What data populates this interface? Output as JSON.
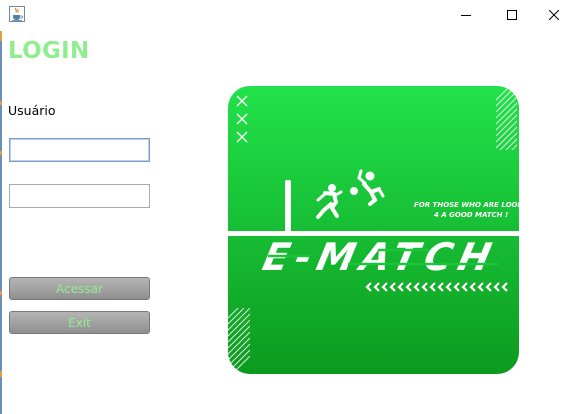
{
  "window": {
    "icon": "java-cup-icon",
    "controls": [
      "minimize-icon",
      "maximize-icon",
      "close-icon"
    ]
  },
  "form": {
    "title": "LOGIN",
    "user_label": "Usuário",
    "user_value": "",
    "password_value": "",
    "submit_label": "Acessar",
    "exit_label": "Exit"
  },
  "logo": {
    "name": "E-MATCH",
    "tagline_line1": "FOR THOSE WHO ARE LOOKING",
    "tagline_line2": "4 A GOOD MATCH !",
    "colors": {
      "background_top": "#22e24a",
      "background_bottom": "#0c9a1e",
      "accent": "#ffffff"
    }
  },
  "colors": {
    "title": "#90ee90",
    "button_text": "#90ee90",
    "button_bg": "#a3a3a3",
    "focus_border": "#7a9cc6"
  }
}
